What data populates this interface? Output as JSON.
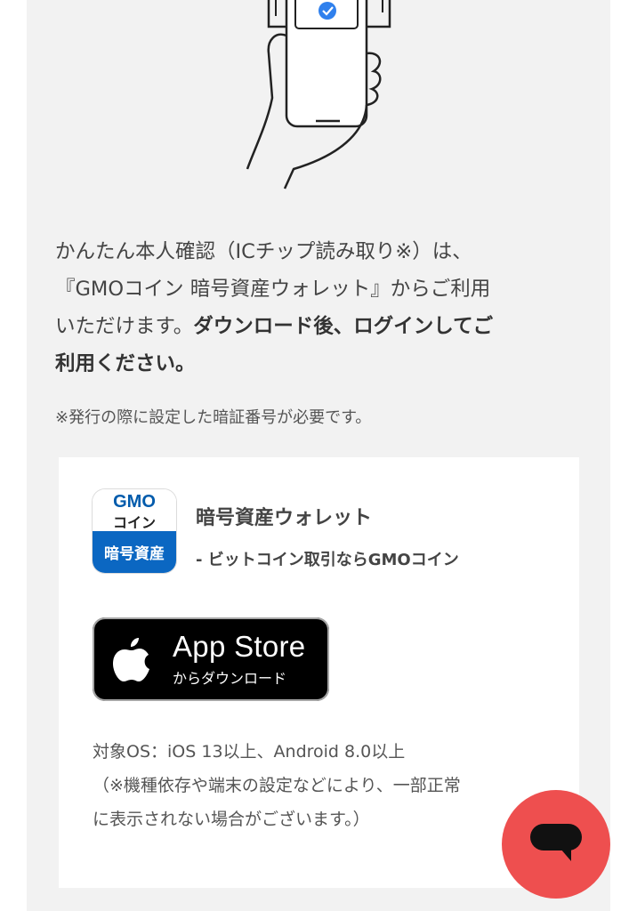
{
  "intro": {
    "part1": "かんたん本人確認（ICチップ読み取り※）は、",
    "part2": "『GMOコイン 暗号資産ウォレット』からご利用",
    "part3": "いただけます。",
    "part3_bold": "ダウンロード後、ログインしてご",
    "part4_bold": "利用ください。"
  },
  "note": "※発行の際に設定した暗証番号が必要です。",
  "app": {
    "icon_logo": "GMO",
    "icon_coin": "コイン",
    "icon_asset": "暗号資産",
    "name": "暗号資産ウォレット",
    "subtitle": "- ビットコイン取引ならGMOコイン"
  },
  "store_badge": {
    "title": "App Store",
    "subtitle": "からダウンロード",
    "icon": "apple-logo-icon"
  },
  "os_info": {
    "line1": "対象OS：iOS 13以上、Android 8.0以上",
    "line2": "（※機種依存や端末の設定などにより、一部正常",
    "line3": "に表示されない場合がございます。）"
  },
  "chat_button": {
    "icon": "chat-bubble-icon",
    "color": "#ee4f4f"
  },
  "colors": {
    "panel_bg": "#f2f2f2",
    "check_blue": "#2f80ed",
    "icon_blue": "#0b67c2"
  }
}
